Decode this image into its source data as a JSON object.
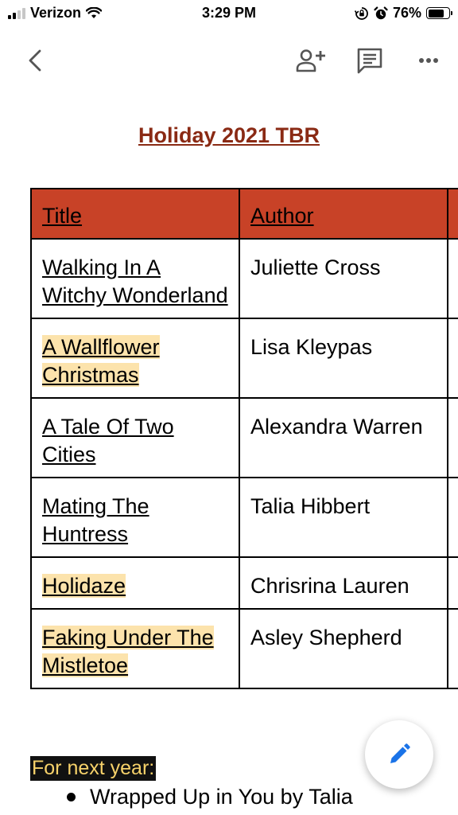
{
  "status_bar": {
    "carrier": "Verizon",
    "time": "3:29 PM",
    "battery": "76%",
    "battery_level": 0.76,
    "icons": [
      "signal-icon",
      "wifi-icon",
      "orientation-lock-icon",
      "alarm-icon",
      "battery-icon"
    ]
  },
  "toolbar": {
    "icons": [
      "back-icon",
      "add-person-icon",
      "comment-icon",
      "more-icon"
    ]
  },
  "document": {
    "title": "Holiday 2021 TBR",
    "table": {
      "headers": [
        "Title",
        "Author"
      ],
      "rows": [
        {
          "title": "Walking In A Witchy Wonderland",
          "author": "Juliette Cross",
          "highlighted": false
        },
        {
          "title": "A Wallflower Christmas",
          "author": "Lisa Kleypas",
          "highlighted": true
        },
        {
          "title": "A Tale Of Two Cities",
          "author": "Alexandra Warren",
          "highlighted": false
        },
        {
          "title": "Mating The Huntress",
          "author": "Talia Hibbert",
          "highlighted": false
        },
        {
          "title": "Holidaze",
          "author": "Chrisrina Lauren",
          "highlighted": true
        },
        {
          "title": "Faking Under The Mistletoe",
          "author": "Asley Shepherd",
          "highlighted": true
        }
      ]
    },
    "next_year_label": "For next year:",
    "next_year_items": [
      "Wrapped Up in You by Talia"
    ]
  },
  "fab": {
    "icon": "edit-pencil-icon"
  },
  "colors": {
    "title": "#8a2a14",
    "header_bg": "#c84227",
    "highlight": "#fce3ac",
    "label_bg": "#111111",
    "label_text": "#f7d26a",
    "fab_icon": "#1a73e8"
  }
}
